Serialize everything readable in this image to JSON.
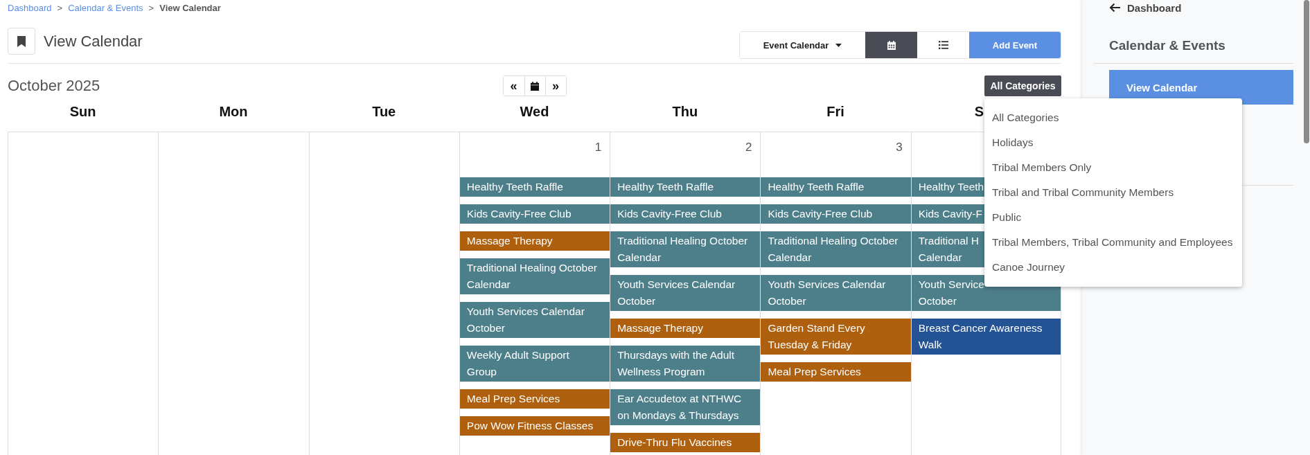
{
  "breadcrumb": [
    {
      "kind": "link",
      "label": "Dashboard"
    },
    {
      "kind": "separator",
      "label": ">"
    },
    {
      "kind": "link",
      "label": "Calendar & Events"
    },
    {
      "kind": "separator",
      "label": ">"
    },
    {
      "kind": "current",
      "label": "View Calendar"
    }
  ],
  "page_title": "View Calendar",
  "toolbar": {
    "calendar_menu": "Event Calendar",
    "view_toggle": [
      {
        "kind": "calendar",
        "selected": true
      },
      {
        "kind": "list",
        "selected": false
      }
    ],
    "add_button": "Add Event"
  },
  "calendar": {
    "month_title": "October 2025",
    "nav": [
      {
        "kind": "prev",
        "label": "«"
      },
      {
        "kind": "today"
      },
      {
        "kind": "next",
        "label": "»"
      }
    ],
    "category_filter": {
      "label": "All Categories",
      "expanded": true,
      "options": [
        "All Categories",
        "Holidays",
        "Tribal Members Only",
        "Tribal and Tribal Community Members",
        "Public",
        "Tribal Members, Tribal Community and Employees",
        "Canoe Journey"
      ]
    },
    "weekdays": [
      "Sun",
      "Mon",
      "Tue",
      "Wed",
      "Thu",
      "Fri",
      "S"
    ],
    "days": [
      {
        "kind": "blank"
      },
      {
        "kind": "blank"
      },
      {
        "kind": "blank"
      },
      {
        "kind": "day",
        "date": "1",
        "events": [
          {
            "title": "Healthy Teeth Raffle",
            "color": "#4d7f8b"
          },
          {
            "title": "Kids Cavity-Free Club",
            "color": "#4d7f8b"
          },
          {
            "title": "Massage Therapy",
            "color": "#ae600e"
          },
          {
            "title": "Traditional Healing October Calendar",
            "color": "#4d7f8b"
          },
          {
            "title": "Youth Services Calendar October",
            "color": "#4d7f8b"
          },
          {
            "title": "Weekly Adult Support Group",
            "color": "#4d7f8b"
          },
          {
            "title": "Meal Prep Services",
            "color": "#ae600e"
          },
          {
            "title": "Pow Wow Fitness Classes",
            "color": "#ae600e"
          }
        ]
      },
      {
        "kind": "day",
        "date": "2",
        "events": [
          {
            "title": "Healthy Teeth Raffle",
            "color": "#4d7f8b"
          },
          {
            "title": "Kids Cavity-Free Club",
            "color": "#4d7f8b"
          },
          {
            "title": "Traditional Healing October Calendar",
            "color": "#4d7f8b"
          },
          {
            "title": "Youth Services Calendar October",
            "color": "#4d7f8b"
          },
          {
            "title": "Massage Therapy",
            "color": "#ae600e"
          },
          {
            "title": "Thursdays with the Adult Wellness Program",
            "color": "#4d7f8b"
          },
          {
            "title": "Ear Accudetox at NTHWC on Mondays & Thursdays",
            "color": "#4d7f8b"
          },
          {
            "title": "Drive-Thru Flu Vaccines",
            "color": "#ae600e"
          }
        ]
      },
      {
        "kind": "day",
        "date": "3",
        "events": [
          {
            "title": "Healthy Teeth Raffle",
            "color": "#4d7f8b"
          },
          {
            "title": "Kids Cavity-Free Club",
            "color": "#4d7f8b"
          },
          {
            "title": "Traditional Healing October Calendar",
            "color": "#4d7f8b"
          },
          {
            "title": "Youth Services Calendar October",
            "color": "#4d7f8b"
          },
          {
            "title": "Garden Stand Every Tuesday & Friday",
            "color": "#ae600e"
          },
          {
            "title": "Meal Prep Services",
            "color": "#ae600e"
          }
        ]
      },
      {
        "kind": "day",
        "events": [
          {
            "title": "Healthy Teeth",
            "color": "#4d7f8b"
          },
          {
            "title": "Kids Cavity-F",
            "color": "#4d7f8b"
          },
          {
            "title": "Traditional H\nCalendar",
            "color": "#4d7f8b"
          },
          {
            "title": "Youth Service\nOctober",
            "color": "#4d7f8b"
          },
          {
            "title": "Breast Cancer Awareness Walk",
            "color": "#235395"
          }
        ]
      }
    ]
  },
  "sidebar": {
    "back_link": "Dashboard",
    "heading": "Calendar & Events",
    "items": [
      {
        "label": "View Calendar",
        "selected": true
      }
    ]
  }
}
